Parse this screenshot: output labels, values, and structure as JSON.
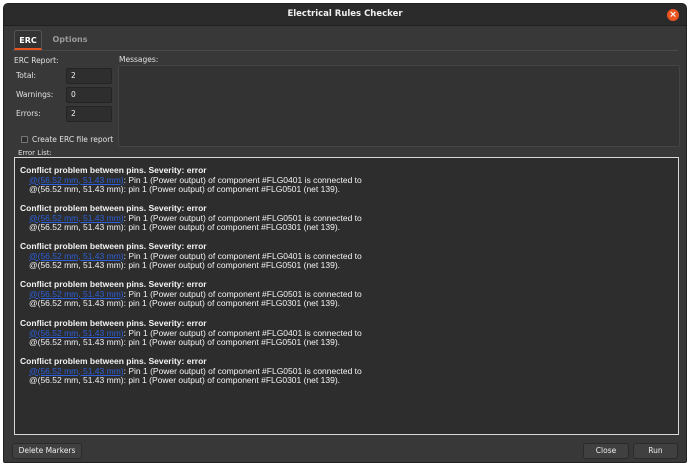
{
  "window": {
    "title": "Electrical Rules Checker"
  },
  "tabs": [
    {
      "label": "ERC",
      "active": true
    },
    {
      "label": "Options",
      "active": false
    }
  ],
  "report": {
    "label": "ERC Report:",
    "total_label": "Total:",
    "total_value": "2",
    "warnings_label": "Warnings:",
    "warnings_value": "0",
    "errors_label": "Errors:",
    "errors_value": "2",
    "create_file_label": "Create ERC file report",
    "create_file_checked": false
  },
  "messages": {
    "label": "Messages:"
  },
  "error_list": {
    "label": "Error List:",
    "items": [
      {
        "title": "Conflict problem between pins. Severity: error",
        "link": "@(56.52 mm, 51.43 mm)",
        "line1_rest": ": Pin 1 (Power output) of component #FLG0401 is connected to",
        "line2": "@(56.52 mm, 51.43 mm): pin 1 (Power output) of component #FLG0501 (net 139)."
      },
      {
        "title": "Conflict problem between pins. Severity: error",
        "link": "@(56.52 mm, 51.43 mm)",
        "line1_rest": ": Pin 1 (Power output) of component #FLG0501 is connected to",
        "line2": "@(56.52 mm, 51.43 mm): pin 1 (Power output) of component #FLG0301 (net 139)."
      },
      {
        "title": "Conflict problem between pins. Severity: error",
        "link": "@(56.52 mm, 51.43 mm)",
        "line1_rest": ": Pin 1 (Power output) of component #FLG0401 is connected to",
        "line2": "@(56.52 mm, 51.43 mm): pin 1 (Power output) of component #FLG0501 (net 139)."
      },
      {
        "title": "Conflict problem between pins. Severity: error",
        "link": "@(56.52 mm, 51.43 mm)",
        "line1_rest": ": Pin 1 (Power output) of component #FLG0501 is connected to",
        "line2": "@(56.52 mm, 51.43 mm): pin 1 (Power output) of component #FLG0301 (net 139)."
      },
      {
        "title": "Conflict problem between pins. Severity: error",
        "link": "@(56.52 mm, 51.43 mm)",
        "line1_rest": ": Pin 1 (Power output) of component #FLG0401 is connected to",
        "line2": "@(56.52 mm, 51.43 mm): pin 1 (Power output) of component #FLG0501 (net 139)."
      },
      {
        "title": "Conflict problem between pins. Severity: error",
        "link": "@(56.52 mm, 51.43 mm)",
        "line1_rest": ": Pin 1 (Power output) of component #FLG0501 is connected to",
        "line2": "@(56.52 mm, 51.43 mm): pin 1 (Power output) of component #FLG0301 (net 139)."
      }
    ]
  },
  "buttons": {
    "delete_markers": "Delete Markers",
    "close": "Close",
    "run": "Run"
  },
  "colors": {
    "accent": "#e95420",
    "link": "#2c5fd8"
  }
}
